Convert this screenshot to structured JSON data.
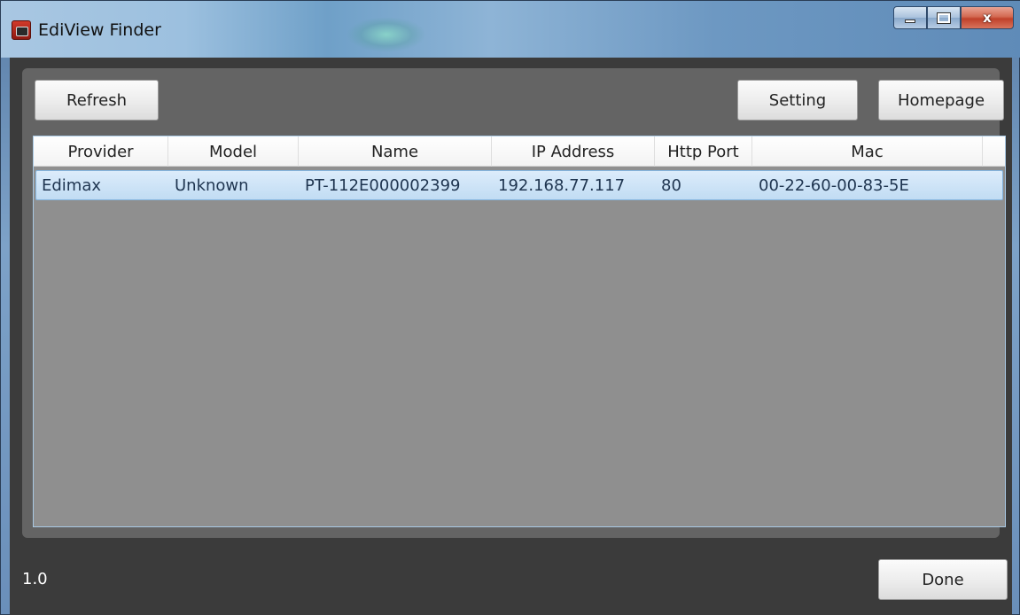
{
  "window": {
    "title": "EdiView Finder",
    "close_glyph": "x"
  },
  "toolbar": {
    "refresh_label": "Refresh",
    "setting_label": "Setting",
    "homepage_label": "Homepage"
  },
  "table": {
    "columns": [
      "Provider",
      "Model",
      "Name",
      "IP Address",
      "Http Port",
      "Mac"
    ],
    "rows": [
      {
        "provider": "Edimax",
        "model": "Unknown",
        "name": "PT-112E000002399",
        "ip": "192.168.77.117",
        "port": "80",
        "mac": "00-22-60-00-83-5E",
        "selected": true
      }
    ]
  },
  "footer": {
    "version": "1.0",
    "done_label": "Done"
  },
  "colors": {
    "selection": "#c8e1f7",
    "panel": "#646464",
    "list_bg": "#8f8f8f"
  }
}
